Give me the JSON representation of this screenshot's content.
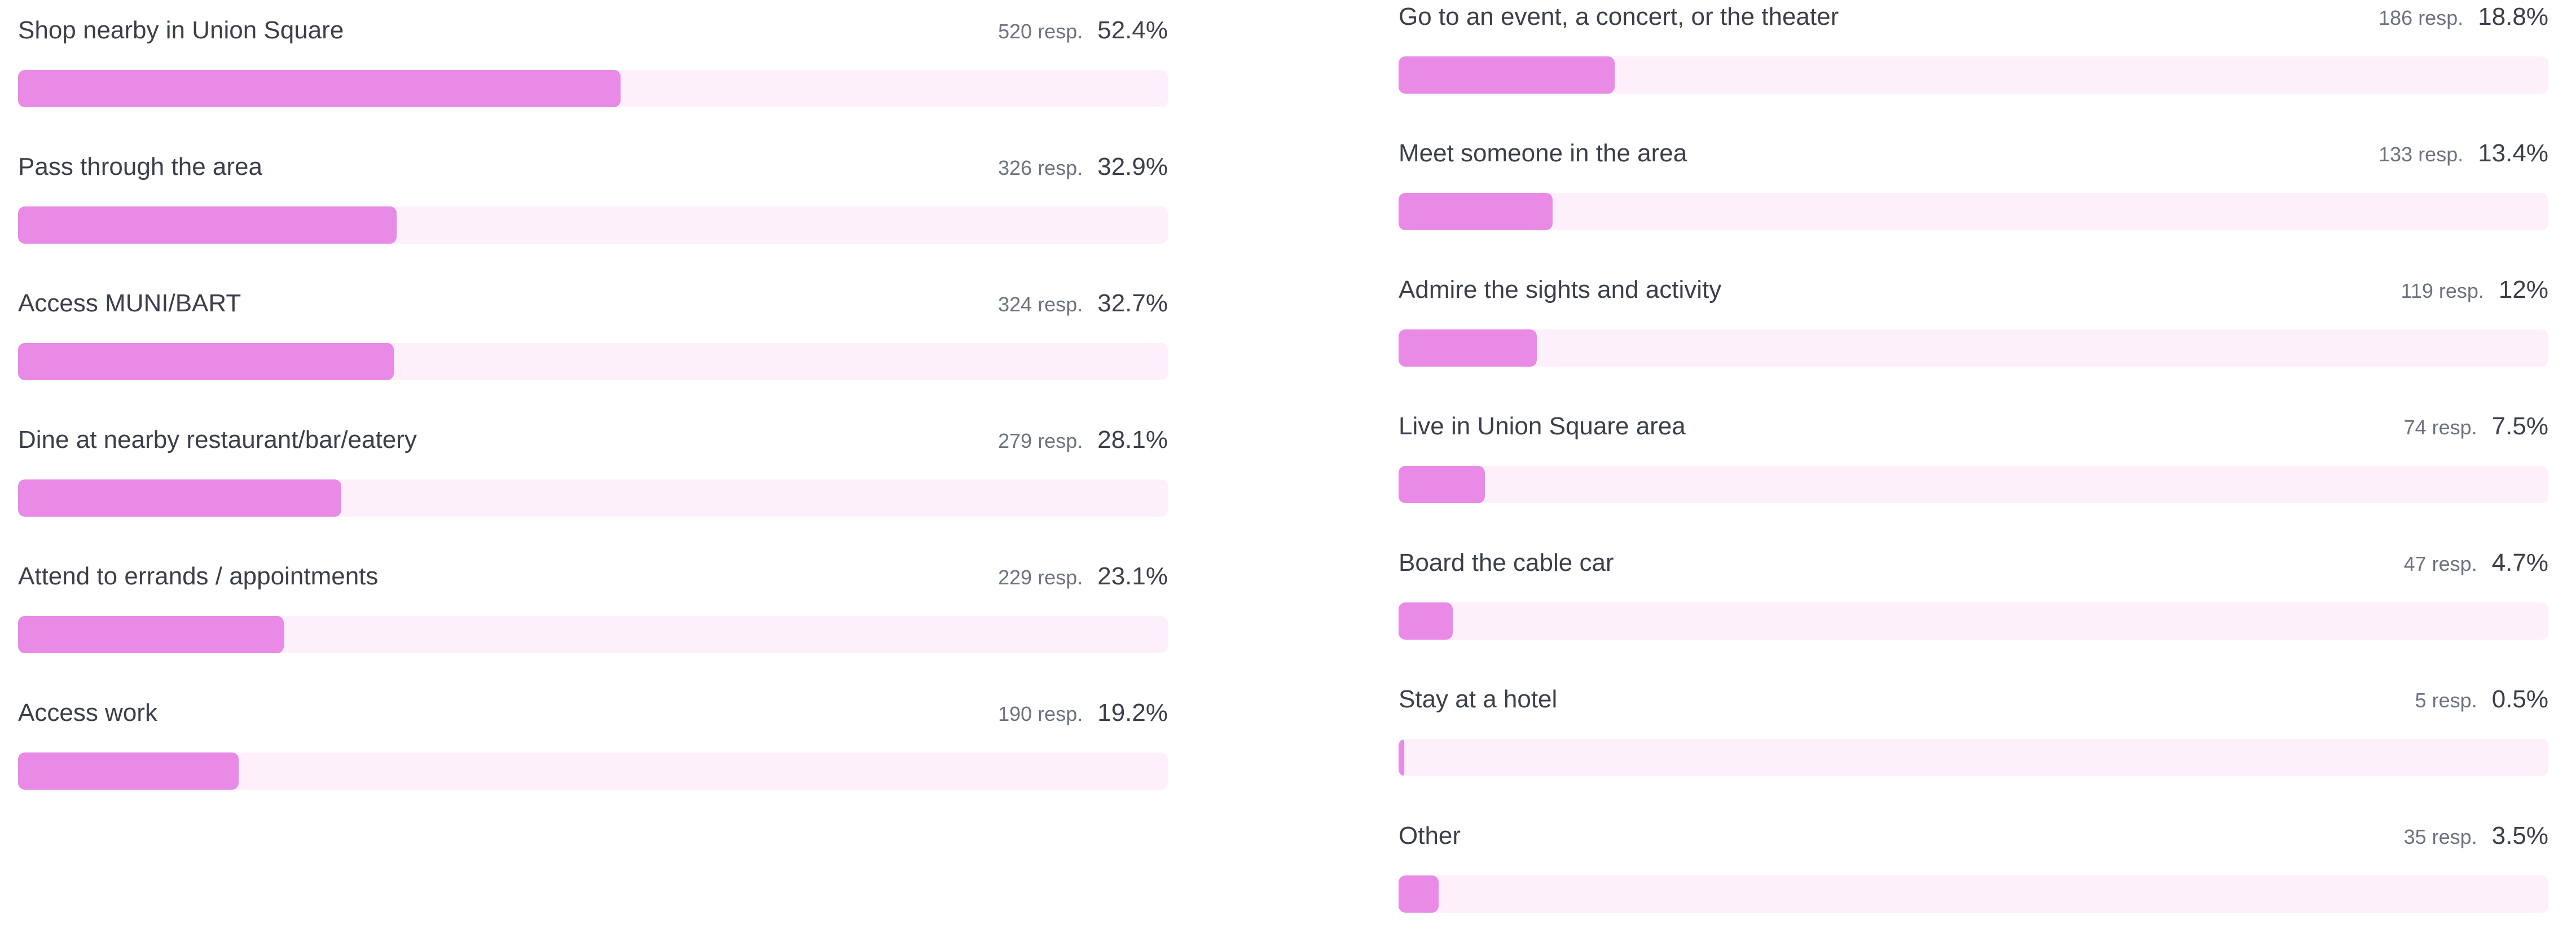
{
  "colors": {
    "bar_fill": "#e88ae6",
    "bar_track": "#fdf0fb",
    "label_text": "#3a3f4a",
    "resp_text": "#6b7280"
  },
  "chart_data": {
    "type": "bar",
    "orientation": "horizontal",
    "xlim": [
      0,
      100
    ],
    "columns": [
      {
        "items": [
          {
            "label": "Shop nearby in Union Square",
            "resp": "520 resp.",
            "pct": "52.4%",
            "value": 52.4
          },
          {
            "label": "Pass through the area",
            "resp": "326 resp.",
            "pct": "32.9%",
            "value": 32.9
          },
          {
            "label": "Access MUNI/BART",
            "resp": "324 resp.",
            "pct": "32.7%",
            "value": 32.7
          },
          {
            "label": "Dine at nearby restaurant/bar/eatery",
            "resp": "279 resp.",
            "pct": "28.1%",
            "value": 28.1
          },
          {
            "label": "Attend to errands / appointments",
            "resp": "229 resp.",
            "pct": "23.1%",
            "value": 23.1
          },
          {
            "label": "Access work",
            "resp": "190 resp.",
            "pct": "19.2%",
            "value": 19.2
          }
        ]
      },
      {
        "items": [
          {
            "label": "Go to an event, a concert, or the theater",
            "resp": "186 resp.",
            "pct": "18.8%",
            "value": 18.8
          },
          {
            "label": "Meet someone in the area",
            "resp": "133 resp.",
            "pct": "13.4%",
            "value": 13.4
          },
          {
            "label": "Admire the sights and activity",
            "resp": "119 resp.",
            "pct": "12%",
            "value": 12
          },
          {
            "label": "Live in Union Square area",
            "resp": "74 resp.",
            "pct": "7.5%",
            "value": 7.5
          },
          {
            "label": "Board the cable car",
            "resp": "47 resp.",
            "pct": "4.7%",
            "value": 4.7
          },
          {
            "label": "Stay at a hotel",
            "resp": "5 resp.",
            "pct": "0.5%",
            "value": 0.5
          },
          {
            "label": "Other",
            "resp": "35 resp.",
            "pct": "3.5%",
            "value": 3.5
          }
        ]
      }
    ]
  }
}
